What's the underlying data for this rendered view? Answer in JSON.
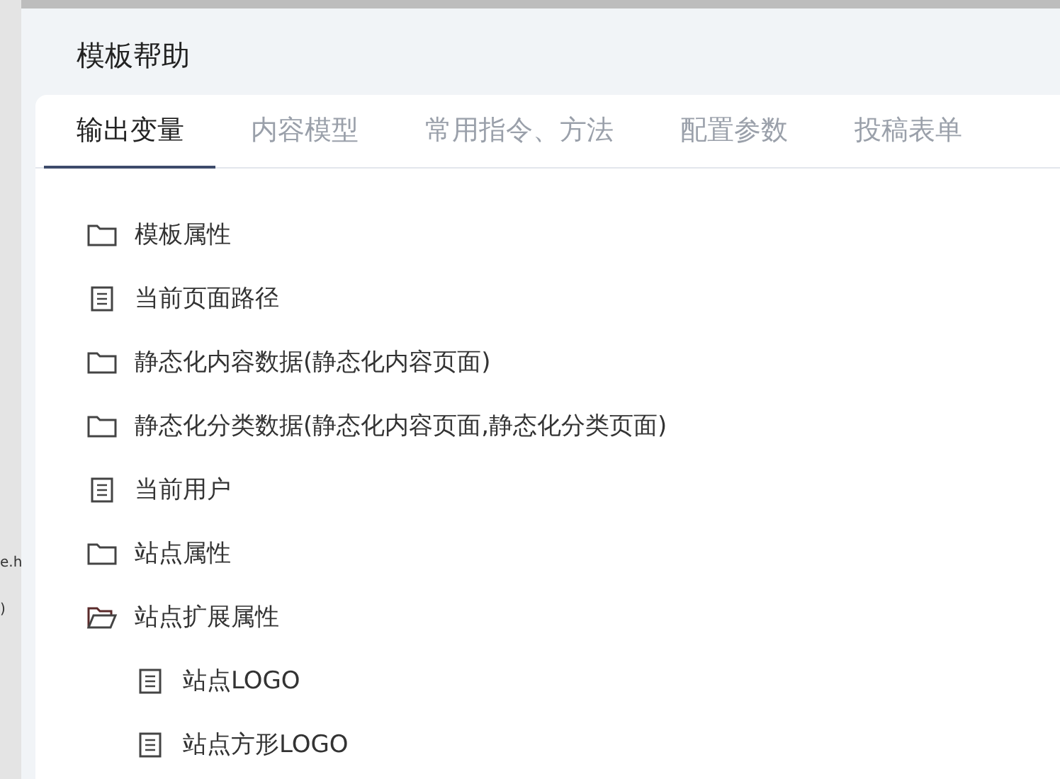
{
  "background": {
    "fragments": [
      "e.h",
      ")"
    ]
  },
  "dialog": {
    "title": "模板帮助"
  },
  "tabs": [
    {
      "label": "输出变量",
      "selected": true
    },
    {
      "label": "内容模型",
      "selected": false
    },
    {
      "label": "常用指令、方法",
      "selected": false
    },
    {
      "label": "配置参数",
      "selected": false
    },
    {
      "label": "投稿表单",
      "selected": false
    }
  ],
  "tree": [
    {
      "kind": "folder",
      "label": "模板属性",
      "expanded": false
    },
    {
      "kind": "file",
      "label": "当前页面路径"
    },
    {
      "kind": "folder",
      "label": "静态化内容数据(静态化内容页面)",
      "expanded": false
    },
    {
      "kind": "folder",
      "label": "静态化分类数据(静态化内容页面,静态化分类页面)",
      "expanded": false
    },
    {
      "kind": "file",
      "label": "当前用户"
    },
    {
      "kind": "folder",
      "label": "站点属性",
      "expanded": false
    },
    {
      "kind": "folder",
      "label": "站点扩展属性",
      "expanded": true,
      "children": [
        {
          "kind": "file",
          "label": "站点LOGO"
        },
        {
          "kind": "file",
          "label": "站点方形LOGO"
        }
      ]
    }
  ]
}
